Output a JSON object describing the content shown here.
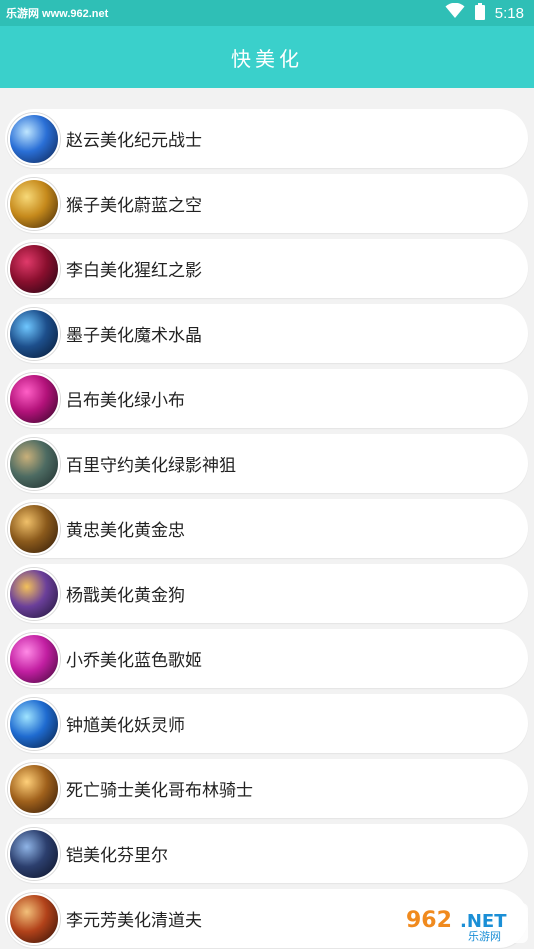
{
  "status_bar": {
    "watermark": "乐游网 www.962.net",
    "time": "5:18",
    "icons": [
      "wifi-icon",
      "battery-icon"
    ]
  },
  "header": {
    "title": "快美化"
  },
  "items": [
    {
      "label": "赵云美化纪元战士",
      "colors": [
        "#0b1f4a",
        "#2a6fd6",
        "#bfe6ff"
      ]
    },
    {
      "label": "猴子美化蔚蓝之空",
      "colors": [
        "#3a2206",
        "#c68a1c",
        "#f7d978"
      ]
    },
    {
      "label": "李白美化猩红之影",
      "colors": [
        "#1a0510",
        "#8a0f2e",
        "#e03a6a"
      ]
    },
    {
      "label": "墨子美化魔术水晶",
      "colors": [
        "#05152e",
        "#1d4f8c",
        "#6fc7ff"
      ]
    },
    {
      "label": "吕布美化绿小布",
      "colors": [
        "#2a0522",
        "#b3127a",
        "#ff5fc6"
      ]
    },
    {
      "label": "百里守约美化绿影神狙",
      "colors": [
        "#1c2a2a",
        "#4d6b62",
        "#c9b07a"
      ]
    },
    {
      "label": "黄忠美化黄金忠",
      "colors": [
        "#2a1606",
        "#8b5a1c",
        "#f0c06a"
      ]
    },
    {
      "label": "杨戬美化黄金狗",
      "colors": [
        "#1b1230",
        "#6b3f9a",
        "#f3c15a"
      ]
    },
    {
      "label": "小乔美化蓝色歌姬",
      "colors": [
        "#3a0532",
        "#c21fa2",
        "#ff8ae6"
      ]
    },
    {
      "label": "钟馗美化妖灵师",
      "colors": [
        "#061a3a",
        "#1f6bd0",
        "#9fe4ff"
      ]
    },
    {
      "label": "死亡骑士美化哥布林骑士",
      "colors": [
        "#2a1405",
        "#a0611c",
        "#ffd07a"
      ]
    },
    {
      "label": "铠美化芬里尔",
      "colors": [
        "#0a0f22",
        "#2c3f6e",
        "#8fb4e6"
      ]
    },
    {
      "label": "李元芳美化清道夫",
      "colors": [
        "#2a0e06",
        "#b2421a",
        "#f2c07a"
      ]
    }
  ],
  "watermark_badge": {
    "number": "962",
    "suffix": ".NET",
    "site": "乐游网"
  },
  "theme": {
    "status_bar": "#2fbfb6",
    "header": "#3ad0cb",
    "background": "#f2f2f2"
  }
}
